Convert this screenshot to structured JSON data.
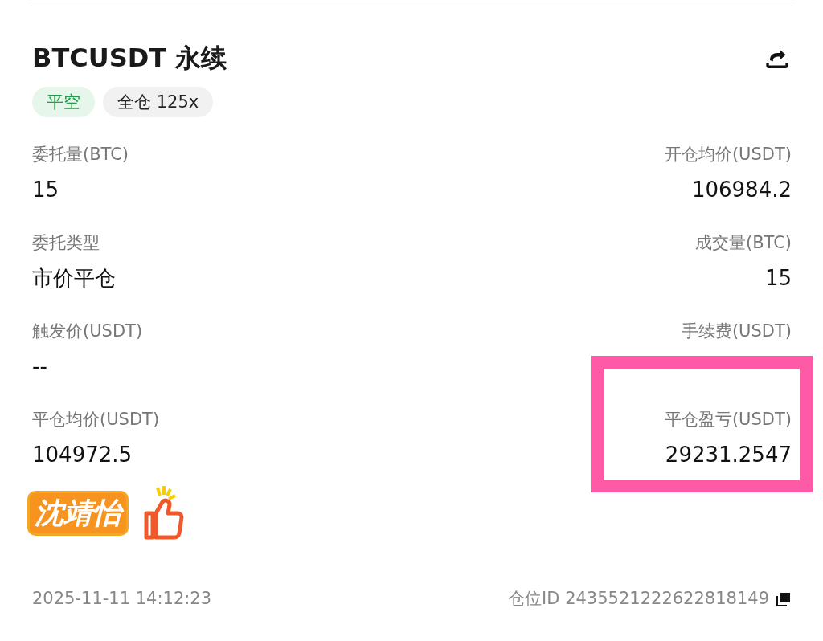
{
  "title": "BTCUSDT 永续",
  "tags": [
    {
      "label": "平空",
      "kind": "side"
    },
    {
      "label": "全仓 125x",
      "kind": "margin"
    }
  ],
  "fields": [
    {
      "label": "委托量(BTC)",
      "value": "15"
    },
    {
      "label": "开仓均价(USDT)",
      "value": "106984.2"
    },
    {
      "label": "委托类型",
      "value": "市价平仓"
    },
    {
      "label": "成交量(BTC)",
      "value": "15"
    },
    {
      "label": "触发价(USDT)",
      "value": "--"
    },
    {
      "label": "手续费(USDT)"
    },
    {
      "label": "平仓均价(USDT)",
      "value": "104972.5"
    },
    {
      "label": "平仓盈亏(USDT)",
      "value": "29231.2547"
    }
  ],
  "sticker": {
    "text": "沈靖怡"
  },
  "footer": {
    "time": "2025-11-11 14:12:23",
    "position_id": "仓位ID 2435521222622818149"
  }
}
